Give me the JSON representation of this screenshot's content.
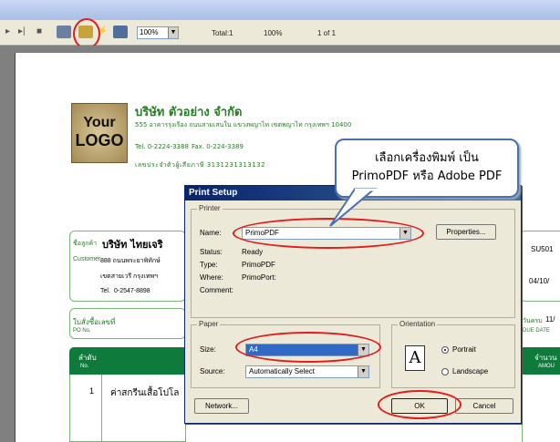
{
  "toolbar": {
    "zoom_value": "100%",
    "total": "Total:1",
    "zoom_pct": "100%",
    "page_of": "1 of 1"
  },
  "logo": {
    "line1": "Your",
    "line2": "LOGO"
  },
  "company": {
    "name": "บริษัท ตัวอย่าง จำกัด",
    "address": "555 อาคารรุ่งเรือง ถนนสามเสนใน แขวงพญาไท เขตพญาไท กรุงเทพฯ 10400",
    "tel": "Tel. 0-2224-3388",
    "fax": "Fax. 0-224-3389",
    "taxid": "เลขประจำตัวผู้เสียภาษี  3131231313132"
  },
  "customer": {
    "label_th": "ชื่อลูกค้า",
    "label_en": "Customer",
    "name": "บริษัท ไทยเจริ",
    "addr1": "888 ถนนพระยาพิทักษ์",
    "addr2": "เขตสายเวรี กรุงเทพฯ",
    "tel_label": "Tel.",
    "tel": "0-2547-8898",
    "code": "SU501",
    "date": "04/10/"
  },
  "po": {
    "label_th": "ใบสั่งซื้อเลขที่",
    "label_en": "PO No.",
    "due_th": "วันครบ",
    "due_en": "DUE DATE",
    "due_value": "11/"
  },
  "table": {
    "col_no_th": "ลำดับ",
    "col_no_en": "No.",
    "col_amt_th": "จำนวน",
    "col_amt_en": "AMOU",
    "row1_no": "1",
    "row1_desc": "ค่าสกรีนเสื้อโปโล"
  },
  "callout": {
    "line1": "เลือกเครื่องพิมพ์ เป็น",
    "line2": "PrimoPDF หรือ Adobe PDF"
  },
  "dialog": {
    "title": "Print Setup",
    "printer_group": "Printer",
    "name_label": "Name:",
    "name_value": "PrimoPDF",
    "properties": "Properties...",
    "status_label": "Status:",
    "status_value": "Ready",
    "type_label": "Type:",
    "type_value": "PrimoPDF",
    "where_label": "Where:",
    "where_value": "PrimoPort:",
    "comment_label": "Comment:",
    "paper_group": "Paper",
    "size_label": "Size:",
    "size_value": "A4",
    "source_label": "Source:",
    "source_value": "Automatically Select",
    "orientation_group": "Orientation",
    "portrait": "Portrait",
    "landscape": "Landscape",
    "network": "Network...",
    "ok": "OK",
    "cancel": "Cancel"
  }
}
